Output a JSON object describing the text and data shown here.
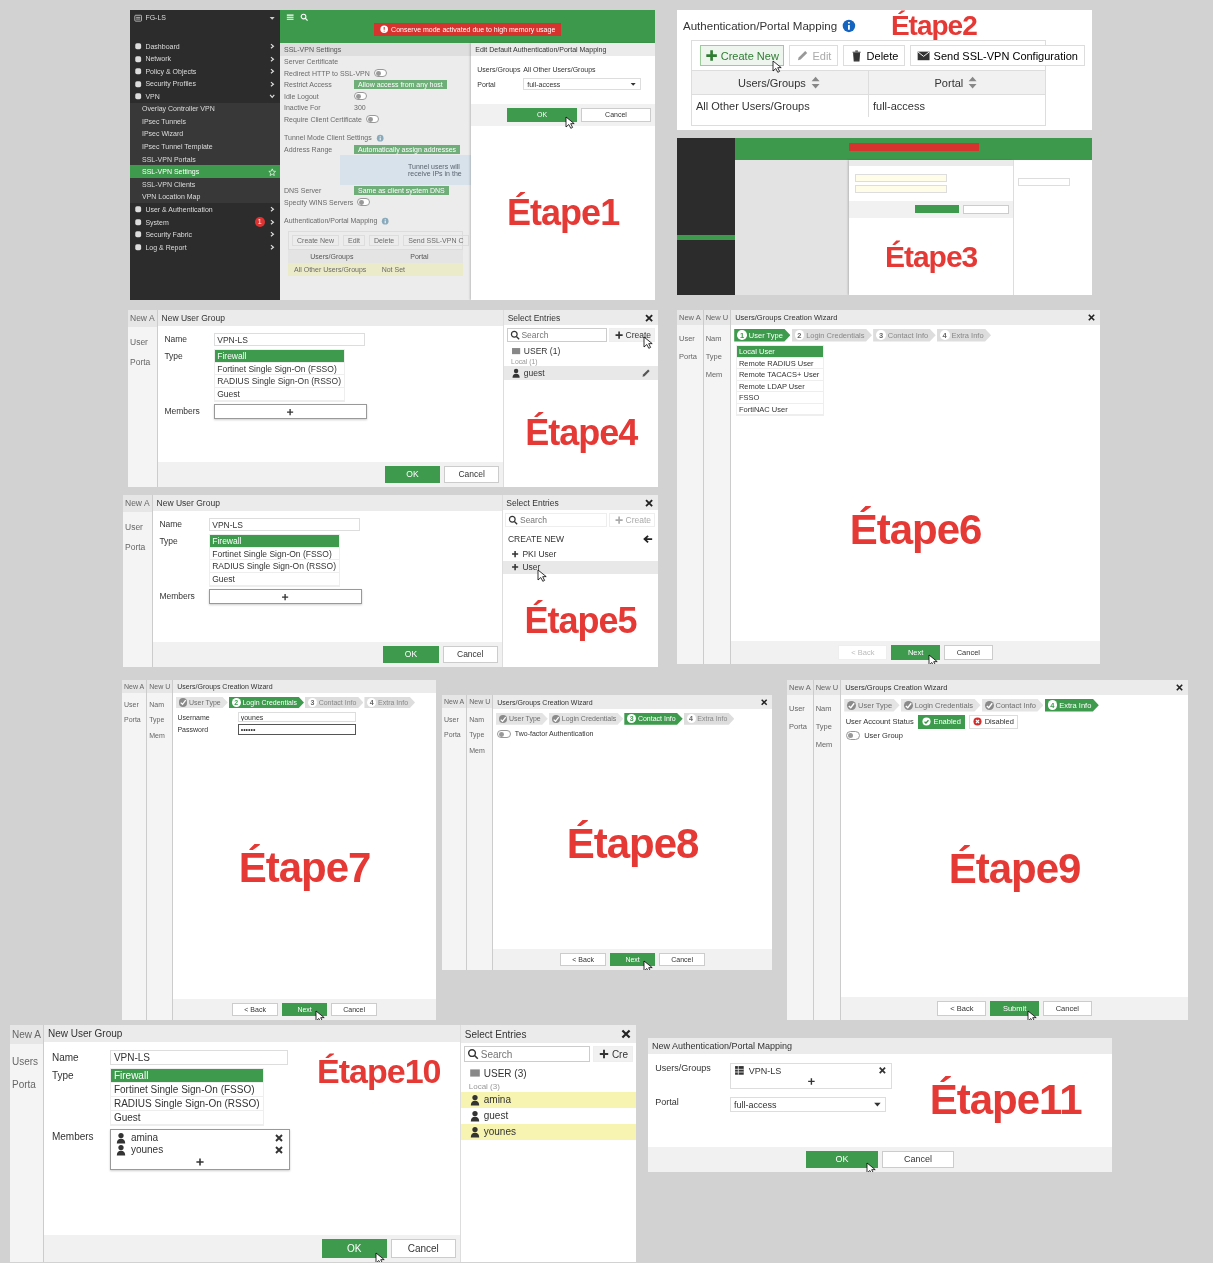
{
  "panels": [
    {
      "kind": "admin_page",
      "step": "Étape1",
      "device": "FG-LS",
      "banner": "Conserve mode activated due to high memory usage",
      "sidebar": [
        {
          "label": "Dashboard",
          "selected": false,
          "expanded": false
        },
        {
          "label": "Network",
          "selected": false,
          "expanded": false
        },
        {
          "label": "Policy & Objects",
          "selected": false,
          "expanded": false
        },
        {
          "label": "Security Profiles",
          "selected": false,
          "expanded": false
        },
        {
          "label": "VPN",
          "selected": false,
          "expanded": true,
          "children": [
            {
              "label": "Overlay Controller VPN",
              "selected": false
            },
            {
              "label": "IPsec Tunnels",
              "selected": false
            },
            {
              "label": "IPsec Wizard",
              "selected": false
            },
            {
              "label": "IPsec Tunnel Template",
              "selected": false
            },
            {
              "label": "SSL-VPN Portals",
              "selected": false
            },
            {
              "label": "SSL-VPN Settings",
              "selected": true
            },
            {
              "label": "SSL-VPN Clients",
              "selected": false
            },
            {
              "label": "VPN Location Map",
              "selected": false
            }
          ]
        },
        {
          "label": "User & Authentication",
          "selected": false,
          "expanded": false
        },
        {
          "label": "System",
          "selected": false,
          "expanded": false,
          "badge": "1"
        },
        {
          "label": "Security Fabric",
          "selected": false,
          "expanded": false
        },
        {
          "label": "Log & Report",
          "selected": false,
          "expanded": false
        }
      ],
      "settings": {
        "title": "SSL-VPN Settings",
        "rows": [
          {
            "kind": "field",
            "label": "Server Certificate"
          },
          {
            "kind": "toggle",
            "label": "Redirect HTTP to SSL-VPN",
            "on": false
          },
          {
            "kind": "button",
            "label": "Restrict Access",
            "value": "Allow access from any host"
          },
          {
            "kind": "toggle",
            "label": "Idle Logout",
            "on": false
          },
          {
            "kind": "field",
            "label": "Inactive For",
            "value": "300"
          },
          {
            "kind": "toggle",
            "label": "Require Client Certificate",
            "on": false
          },
          {
            "kind": "heading",
            "label": "Tunnel Mode Client Settings"
          },
          {
            "kind": "button",
            "label": "Address Range",
            "value": "Automatically assign addresses"
          },
          {
            "kind": "note",
            "label": "Tunnel users will receive IPs in the"
          },
          {
            "kind": "button",
            "label": "DNS Server",
            "value": "Same as client system DNS"
          },
          {
            "kind": "toggle",
            "label": "Specify WINS Servers",
            "on": false
          },
          {
            "kind": "heading",
            "label": "Authentication/Portal Mapping"
          }
        ]
      },
      "mapping": {
        "buttons": [
          "Create New",
          "Edit",
          "Delete",
          "Send SSL-VPN C"
        ],
        "columns": [
          "Users/Groups",
          "Portal"
        ],
        "rows": [
          [
            "All Other Users/Groups",
            "Not Set"
          ]
        ]
      },
      "dialog": {
        "title": "Edit Default Authentication/Portal Mapping",
        "fields": [
          {
            "kind": "text",
            "label": "Users/Groups",
            "value": "All Other Users/Groups"
          },
          {
            "kind": "select",
            "label": "Portal",
            "value": "full-access"
          }
        ],
        "buttons": [
          {
            "label": "OK",
            "kind": "primary",
            "hovered": true
          },
          {
            "label": "Cancel",
            "kind": "secondary",
            "hovered": false
          }
        ]
      }
    },
    {
      "kind": "mapping_table",
      "step": "Étape2",
      "title": "Authentication/Portal Mapping",
      "buttons": [
        {
          "label": "Create New",
          "kind": "create",
          "disabled": false,
          "hovered": true
        },
        {
          "label": "Edit",
          "kind": "edit",
          "disabled": true,
          "hovered": false
        },
        {
          "label": "Delete",
          "kind": "delete",
          "disabled": false,
          "hovered": false
        },
        {
          "label": "Send SSL-VPN Configuration",
          "kind": "send",
          "disabled": false,
          "hovered": false
        }
      ],
      "columns": [
        "Users/Groups",
        "Portal"
      ],
      "rows": [
        [
          "All Other Users/Groups",
          "full-access"
        ]
      ]
    },
    {
      "kind": "blurred_page",
      "step": "Étape3"
    },
    {
      "kind": "user_group",
      "step": "Étape4",
      "behind": [
        "New A",
        "User",
        "Porta"
      ],
      "title": "New User Group",
      "name_label": "Name",
      "name": "VPN-LS",
      "type_label": "Type",
      "types": [
        {
          "label": "Firewall",
          "selected": true
        },
        {
          "label": "Fortinet Single Sign-On (FSSO)",
          "selected": false
        },
        {
          "label": "RADIUS Single Sign-On (RSSO)",
          "selected": false
        },
        {
          "label": "Guest",
          "selected": false
        }
      ],
      "members_label": "Members",
      "buttons": [
        {
          "label": "OK",
          "kind": "primary",
          "hovered": false
        },
        {
          "label": "Cancel",
          "kind": "secondary",
          "hovered": false
        }
      ],
      "entries": {
        "title": "Select Entries",
        "placeholder": "Search",
        "create": {
          "label": "Create",
          "disabled": false,
          "hovered": true
        },
        "group": "USER (1)",
        "subgroup": "Local (1)",
        "users": [
          {
            "name": "guest",
            "selected": false,
            "hovered": true
          }
        ]
      }
    },
    {
      "kind": "user_group",
      "step": "Étape5",
      "behind": [
        "New A",
        "User",
        "Porta"
      ],
      "title": "New User Group",
      "name_label": "Name",
      "name": "VPN-LS",
      "type_label": "Type",
      "types": [
        {
          "label": "Firewall",
          "selected": true
        },
        {
          "label": "Fortinet Single Sign-On (FSSO)",
          "selected": false
        },
        {
          "label": "RADIUS Single Sign-On (RSSO)",
          "selected": false
        },
        {
          "label": "Guest",
          "selected": false
        }
      ],
      "members_label": "Members",
      "buttons": [
        {
          "label": "OK",
          "kind": "primary",
          "hovered": false
        },
        {
          "label": "Cancel",
          "kind": "secondary",
          "hovered": false
        }
      ],
      "entries": {
        "title": "Select Entries",
        "placeholder": "Search",
        "create": {
          "label": "Create",
          "disabled": true,
          "hovered": false
        },
        "heading": "CREATE NEW",
        "options": [
          {
            "label": "PKI User",
            "hovered": false
          },
          {
            "label": "User",
            "hovered": true
          }
        ]
      }
    },
    {
      "kind": "wizard",
      "step": "Étape6",
      "behind": [
        [
          "New A",
          "User",
          "Porta"
        ],
        [
          "New U",
          "Nam",
          "Type",
          "Mem"
        ]
      ],
      "title": "Users/Groups Creation Wizard",
      "close": true,
      "steps": [
        {
          "num": "1",
          "label": "User Type",
          "selected": true,
          "completed": false
        },
        {
          "num": "2",
          "label": "Login Credentials",
          "selected": false,
          "completed": false
        },
        {
          "num": "3",
          "label": "Contact Info",
          "selected": false,
          "completed": false
        },
        {
          "num": "4",
          "label": "Extra Info",
          "selected": false,
          "completed": false
        }
      ],
      "content": [
        {
          "kind": "option_list",
          "options": [
            {
              "label": "Local User",
              "selected": true
            },
            {
              "label": "Remote RADIUS User",
              "selected": false
            },
            {
              "label": "Remote TACACS+ User",
              "selected": false
            },
            {
              "label": "Remote LDAP User",
              "selected": false
            },
            {
              "label": "FSSO",
              "selected": false
            },
            {
              "label": "FortiNAC User",
              "selected": false
            }
          ]
        }
      ],
      "buttons": [
        {
          "label": "< Back",
          "kind": "back",
          "disabled": true,
          "hovered": false
        },
        {
          "label": "Next",
          "kind": "primary",
          "disabled": false,
          "hovered": true
        },
        {
          "label": "Cancel",
          "kind": "secondary",
          "disabled": false,
          "hovered": false
        }
      ]
    },
    {
      "kind": "wizard",
      "step": "Étape7",
      "behind": [
        [
          "New A",
          "User",
          "Porta"
        ],
        [
          "New U",
          "Nam",
          "Type",
          "Mem"
        ]
      ],
      "title": "Users/Groups Creation Wizard",
      "close": false,
      "steps": [
        {
          "label": "User Type",
          "selected": false,
          "completed": true
        },
        {
          "num": "2",
          "label": "Login Credentials",
          "selected": true,
          "completed": false
        },
        {
          "num": "3",
          "label": "Contact Info",
          "selected": false,
          "completed": false
        },
        {
          "num": "4",
          "label": "Extra Info",
          "selected": false,
          "completed": false
        }
      ],
      "content": [
        {
          "kind": "input",
          "label": "Username",
          "value": "younes",
          "focused": false
        },
        {
          "kind": "input",
          "label": "Password",
          "value": "••••••",
          "focused": true
        }
      ],
      "buttons": [
        {
          "label": "< Back",
          "kind": "back",
          "disabled": false,
          "hovered": false
        },
        {
          "label": "Next",
          "kind": "primary",
          "disabled": false,
          "hovered": true
        },
        {
          "label": "Cancel",
          "kind": "secondary",
          "disabled": false,
          "hovered": false
        }
      ]
    },
    {
      "kind": "wizard",
      "step": "Étape8",
      "behind": [
        [
          "New A",
          "User",
          "Porta"
        ],
        [
          "New U",
          "Nam",
          "Type",
          "Mem"
        ]
      ],
      "title": "Users/Groups Creation Wizard",
      "close": true,
      "steps": [
        {
          "label": "User Type",
          "selected": false,
          "completed": true
        },
        {
          "label": "Login Credentials",
          "selected": false,
          "completed": true
        },
        {
          "num": "3",
          "label": "Contact Info",
          "selected": true,
          "completed": false
        },
        {
          "num": "4",
          "label": "Extra Info",
          "selected": false,
          "completed": false
        }
      ],
      "content": [
        {
          "kind": "toggle",
          "label": "Two-factor Authentication",
          "on": false
        }
      ],
      "buttons": [
        {
          "label": "< Back",
          "kind": "back",
          "disabled": false,
          "hovered": false
        },
        {
          "label": "Next",
          "kind": "primary",
          "disabled": false,
          "hovered": true
        },
        {
          "label": "Cancel",
          "kind": "secondary",
          "disabled": false,
          "hovered": false
        }
      ]
    },
    {
      "kind": "wizard",
      "step": "Étape9",
      "behind": [
        [
          "New A",
          "User",
          "Porta"
        ],
        [
          "New U",
          "Nam",
          "Type",
          "Mem"
        ]
      ],
      "title": "Users/Groups Creation Wizard",
      "close": true,
      "steps": [
        {
          "label": "User Type",
          "selected": false,
          "completed": true
        },
        {
          "label": "Login Credentials",
          "selected": false,
          "completed": true
        },
        {
          "label": "Contact Info",
          "selected": false,
          "completed": true
        },
        {
          "num": "4",
          "label": "Extra Info",
          "selected": true,
          "completed": false
        }
      ],
      "content": [
        {
          "kind": "choice",
          "label": "User Account Status",
          "options": [
            {
              "label": "Enabled",
              "selected": true
            },
            {
              "label": "Disabled",
              "selected": false
            }
          ]
        },
        {
          "kind": "toggle",
          "label": "User Group",
          "on": false
        }
      ],
      "buttons": [
        {
          "label": "< Back",
          "kind": "back",
          "disabled": false,
          "hovered": false
        },
        {
          "label": "Submit",
          "kind": "primary",
          "disabled": false,
          "hovered": true
        },
        {
          "label": "Cancel",
          "kind": "secondary",
          "disabled": false,
          "hovered": false
        }
      ]
    },
    {
      "kind": "user_group",
      "step": "Étape10",
      "behind": [
        "New A",
        "Users",
        "Porta"
      ],
      "title": "New User Group",
      "name_label": "Name",
      "name": "VPN-LS",
      "type_label": "Type",
      "types": [
        {
          "label": "Firewall",
          "selected": true
        },
        {
          "label": "Fortinet Single Sign-On (FSSO)",
          "selected": false
        },
        {
          "label": "RADIUS Single Sign-On (RSSO)",
          "selected": false
        },
        {
          "label": "Guest",
          "selected": false
        }
      ],
      "members_label": "Members",
      "members": [
        "amina",
        "younes"
      ],
      "buttons": [
        {
          "label": "OK",
          "kind": "primary",
          "hovered": true
        },
        {
          "label": "Cancel",
          "kind": "secondary",
          "hovered": false
        }
      ],
      "entries": {
        "title": "Select Entries",
        "placeholder": "Search",
        "create": {
          "label": "Cre",
          "disabled": false,
          "hovered": false
        },
        "group": "USER (3)",
        "subgroup": "Local (3)",
        "users": [
          {
            "name": "amina",
            "selected": true,
            "hovered": false
          },
          {
            "name": "guest",
            "selected": false,
            "hovered": false
          },
          {
            "name": "younes",
            "selected": true,
            "hovered": false
          }
        ]
      }
    },
    {
      "kind": "mapping_dialog",
      "step": "Étape11",
      "title": "New Authentication/Portal Mapping",
      "users_label": "Users/Groups",
      "groups": [
        "VPN-LS"
      ],
      "portal_label": "Portal",
      "portal": "full-access",
      "buttons": [
        {
          "label": "OK",
          "kind": "primary",
          "hovered": true
        },
        {
          "label": "Cancel",
          "kind": "secondary",
          "hovered": false
        }
      ]
    }
  ]
}
